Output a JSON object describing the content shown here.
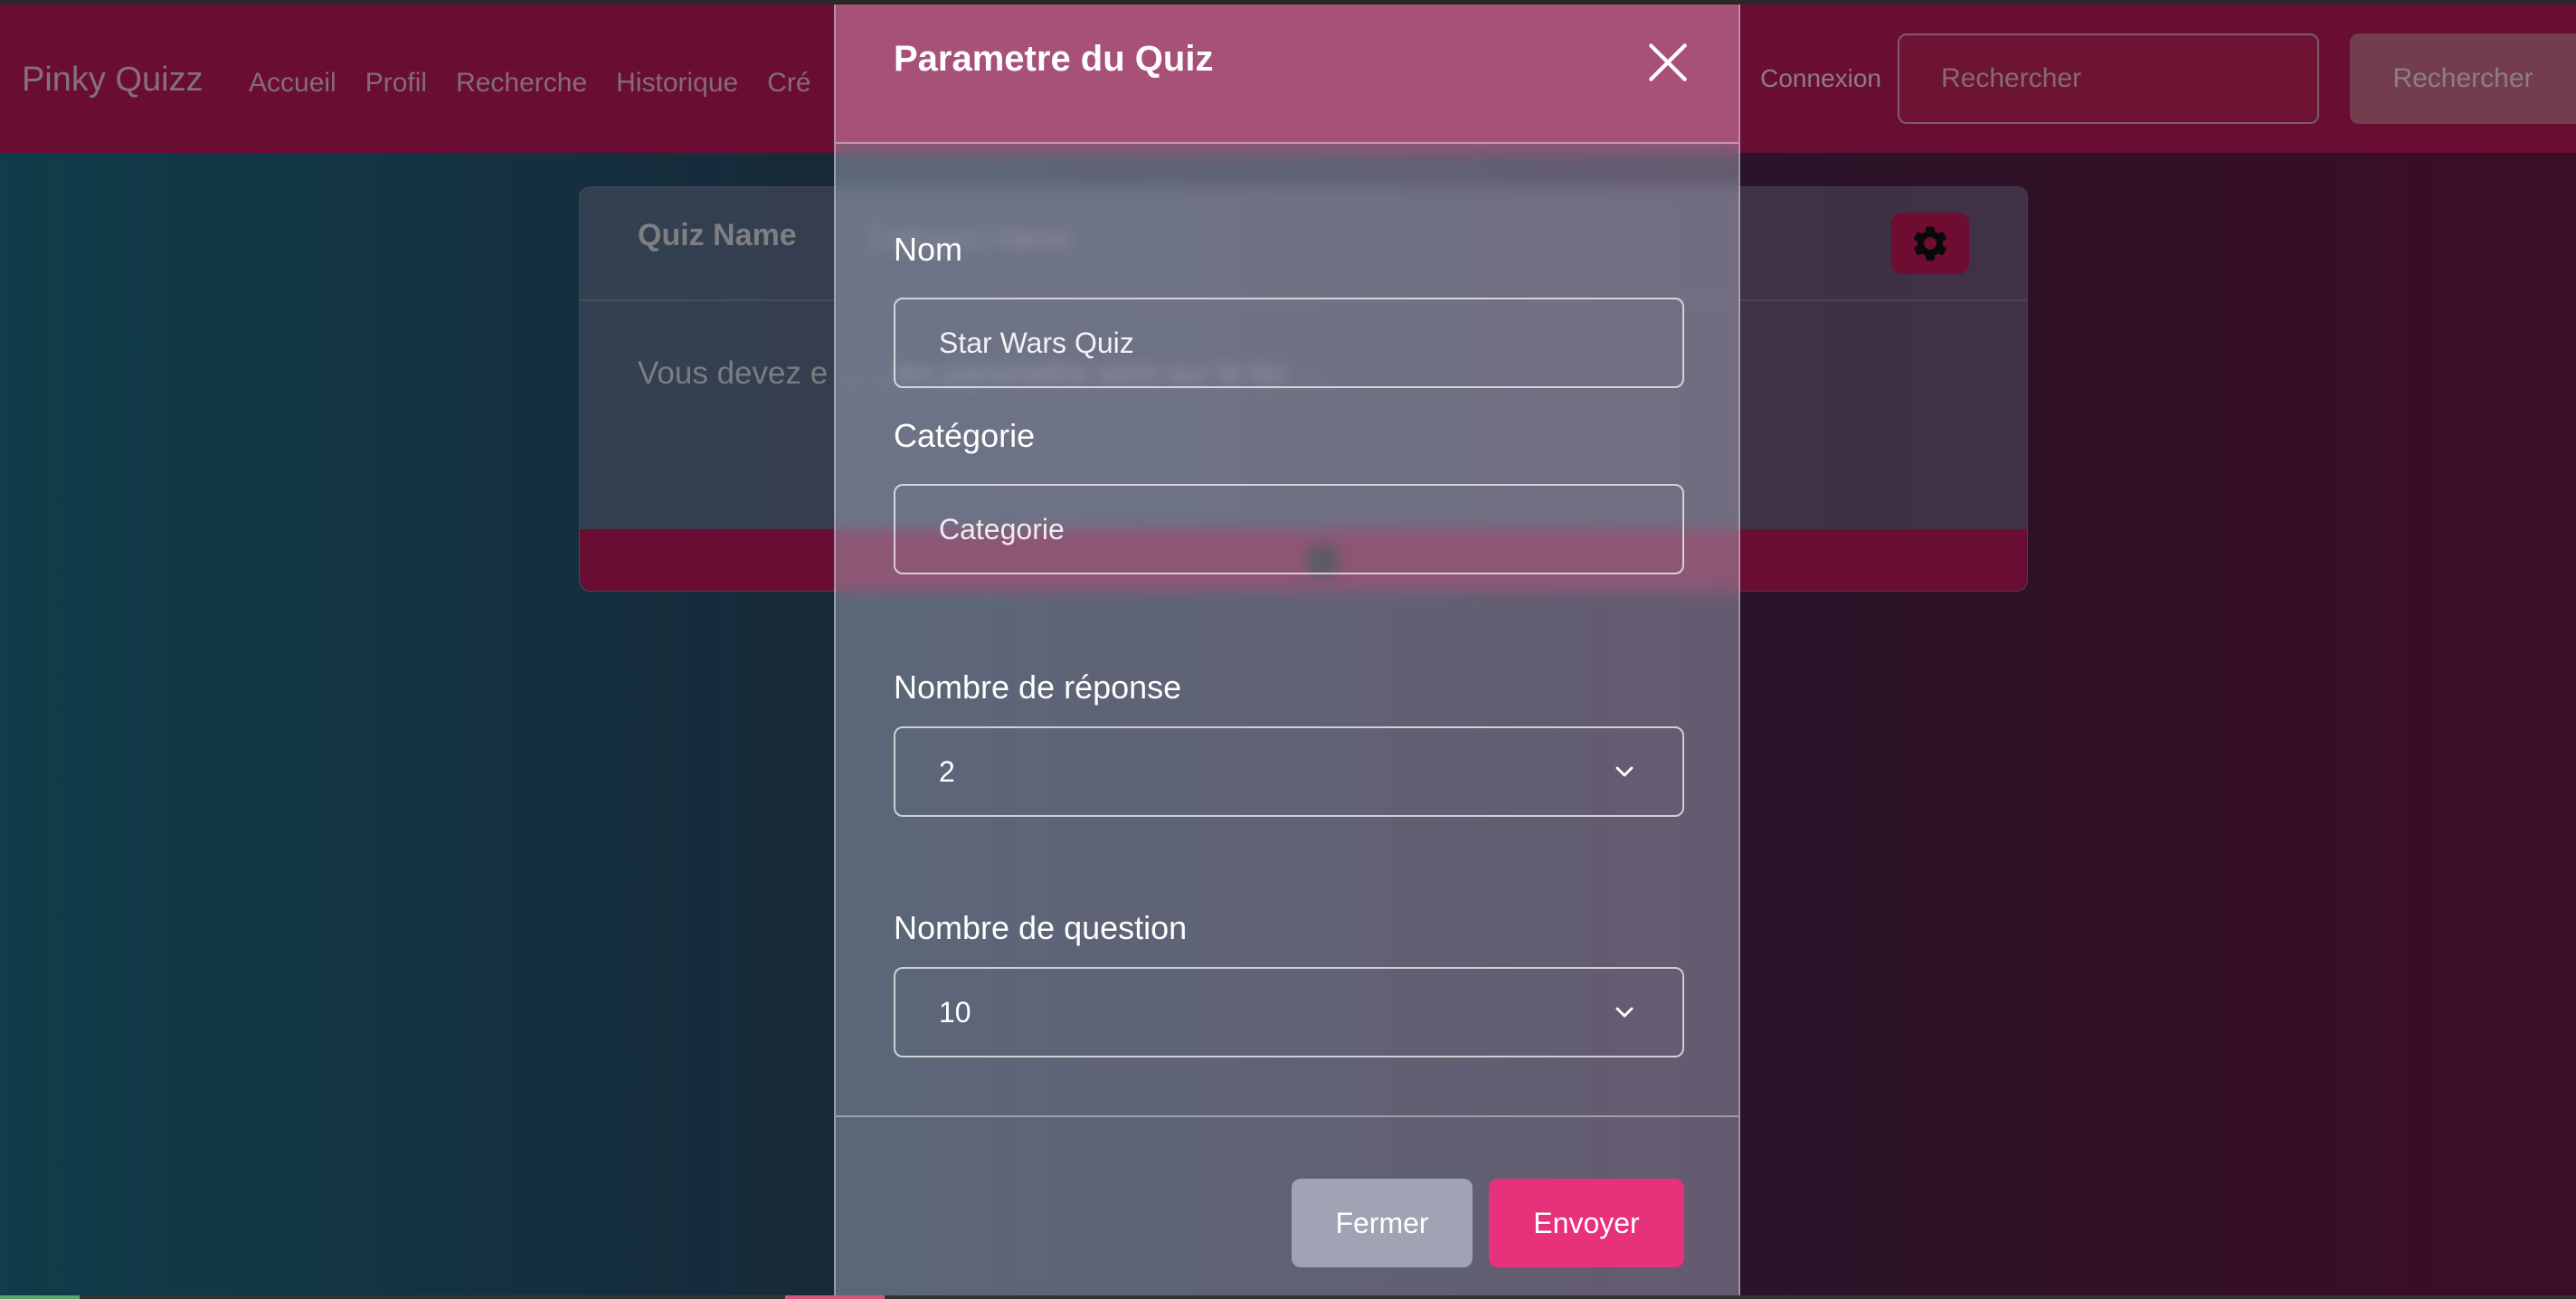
{
  "navbar": {
    "brand": "Pinky Quizz",
    "links": [
      "Accueil",
      "Profil",
      "Recherche",
      "Historique",
      "Cré"
    ],
    "login": "Connexion",
    "search_placeholder": "Rechercher",
    "search_button": "Rechercher"
  },
  "card": {
    "title": "Quiz Name",
    "category": "Category Name",
    "text": "Vous devez e … , les parametre sont sur le bo …"
  },
  "modal": {
    "title": "Parametre du Quiz",
    "name_label": "Nom",
    "name_value": "Star Wars Quiz",
    "category_label": "Catégorie",
    "category_placeholder": "Categorie",
    "answers_label": "Nombre de réponse",
    "answers_value": "2",
    "questions_label": "Nombre de question",
    "questions_value": "10",
    "close_button": "Fermer",
    "send_button": "Envoyer"
  },
  "colors": {
    "brand_pink": "#c2185b",
    "send_button": "#e7317a",
    "close_button": "#9fa3b3"
  },
  "icons": [
    "close-icon",
    "gear-icon",
    "chevron-down-icon"
  ]
}
